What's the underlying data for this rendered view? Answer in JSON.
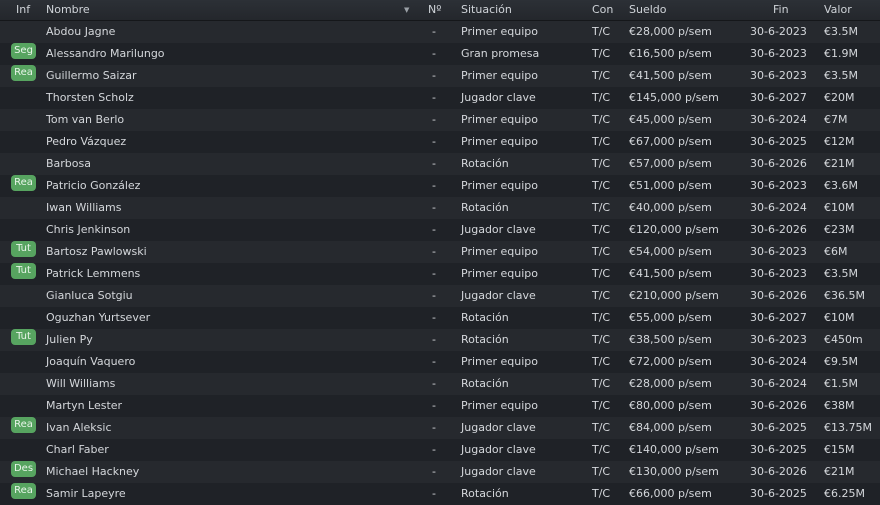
{
  "header": {
    "inf": "Inf",
    "name": "Nombre",
    "number": "Nº",
    "status": "Situación",
    "contract": "Con",
    "salary": "Sueldo",
    "end": "Fin",
    "value": "Valor",
    "sort_icon": "▼"
  },
  "badge_color": "#57a460",
  "players": [
    {
      "badge": "",
      "name": "Abdou Jagne",
      "number": "-",
      "status": "Primer equipo",
      "contract": "T/C",
      "salary": "€28,000 p/sem",
      "end": "30-6-2023",
      "value": "€3.5M"
    },
    {
      "badge": "Seg",
      "name": "Alessandro Marilungo",
      "number": "-",
      "status": "Gran promesa",
      "contract": "T/C",
      "salary": "€16,500 p/sem",
      "end": "30-6-2023",
      "value": "€1.9M"
    },
    {
      "badge": "Rea",
      "name": "Guillermo Saizar",
      "number": "-",
      "status": "Primer equipo",
      "contract": "T/C",
      "salary": "€41,500 p/sem",
      "end": "30-6-2023",
      "value": "€3.5M"
    },
    {
      "badge": "",
      "name": "Thorsten Scholz",
      "number": "-",
      "status": "Jugador clave",
      "contract": "T/C",
      "salary": "€145,000 p/sem",
      "end": "30-6-2027",
      "value": "€20M"
    },
    {
      "badge": "",
      "name": "Tom van Berlo",
      "number": "-",
      "status": "Primer equipo",
      "contract": "T/C",
      "salary": "€45,000 p/sem",
      "end": "30-6-2024",
      "value": "€7M"
    },
    {
      "badge": "",
      "name": "Pedro Vázquez",
      "number": "-",
      "status": "Primer equipo",
      "contract": "T/C",
      "salary": "€67,000 p/sem",
      "end": "30-6-2025",
      "value": "€12M"
    },
    {
      "badge": "",
      "name": "Barbosa",
      "number": "-",
      "status": "Rotación",
      "contract": "T/C",
      "salary": "€57,000 p/sem",
      "end": "30-6-2026",
      "value": "€21M"
    },
    {
      "badge": "Rea",
      "name": "Patricio González",
      "number": "-",
      "status": "Primer equipo",
      "contract": "T/C",
      "salary": "€51,000 p/sem",
      "end": "30-6-2023",
      "value": "€3.6M"
    },
    {
      "badge": "",
      "name": "Iwan Williams",
      "number": "-",
      "status": "Rotación",
      "contract": "T/C",
      "salary": "€40,000 p/sem",
      "end": "30-6-2024",
      "value": "€10M"
    },
    {
      "badge": "",
      "name": "Chris Jenkinson",
      "number": "-",
      "status": "Jugador clave",
      "contract": "T/C",
      "salary": "€120,000 p/sem",
      "end": "30-6-2026",
      "value": "€23M"
    },
    {
      "badge": "Tut",
      "name": "Bartosz Pawlowski",
      "number": "-",
      "status": "Primer equipo",
      "contract": "T/C",
      "salary": "€54,000 p/sem",
      "end": "30-6-2023",
      "value": "€6M"
    },
    {
      "badge": "Tut",
      "name": "Patrick Lemmens",
      "number": "-",
      "status": "Primer equipo",
      "contract": "T/C",
      "salary": "€41,500 p/sem",
      "end": "30-6-2023",
      "value": "€3.5M"
    },
    {
      "badge": "",
      "name": "Gianluca Sotgiu",
      "number": "-",
      "status": "Jugador clave",
      "contract": "T/C",
      "salary": "€210,000 p/sem",
      "end": "30-6-2026",
      "value": "€36.5M"
    },
    {
      "badge": "",
      "name": "Oguzhan Yurtsever",
      "number": "-",
      "status": "Rotación",
      "contract": "T/C",
      "salary": "€55,000 p/sem",
      "end": "30-6-2027",
      "value": "€10M"
    },
    {
      "badge": "Tut",
      "name": "Julien Py",
      "number": "-",
      "status": "Rotación",
      "contract": "T/C",
      "salary": "€38,500 p/sem",
      "end": "30-6-2023",
      "value": "€450m"
    },
    {
      "badge": "",
      "name": "Joaquín Vaquero",
      "number": "-",
      "status": "Primer equipo",
      "contract": "T/C",
      "salary": "€72,000 p/sem",
      "end": "30-6-2024",
      "value": "€9.5M"
    },
    {
      "badge": "",
      "name": "Will Williams",
      "number": "-",
      "status": "Rotación",
      "contract": "T/C",
      "salary": "€28,000 p/sem",
      "end": "30-6-2024",
      "value": "€1.5M"
    },
    {
      "badge": "",
      "name": "Martyn Lester",
      "number": "-",
      "status": "Primer equipo",
      "contract": "T/C",
      "salary": "€80,000 p/sem",
      "end": "30-6-2026",
      "value": "€38M"
    },
    {
      "badge": "Rea",
      "name": "Ivan Aleksic",
      "number": "-",
      "status": "Jugador clave",
      "contract": "T/C",
      "salary": "€84,000 p/sem",
      "end": "30-6-2025",
      "value": "€13.75M"
    },
    {
      "badge": "",
      "name": "Charl Faber",
      "number": "-",
      "status": "Jugador clave",
      "contract": "T/C",
      "salary": "€140,000 p/sem",
      "end": "30-6-2025",
      "value": "€15M"
    },
    {
      "badge": "Des",
      "name": "Michael Hackney",
      "number": "-",
      "status": "Jugador clave",
      "contract": "T/C",
      "salary": "€130,000 p/sem",
      "end": "30-6-2026",
      "value": "€21M"
    },
    {
      "badge": "Rea",
      "name": "Samir Lapeyre",
      "number": "-",
      "status": "Rotación",
      "contract": "T/C",
      "salary": "€66,000 p/sem",
      "end": "30-6-2025",
      "value": "€6.25M"
    }
  ]
}
